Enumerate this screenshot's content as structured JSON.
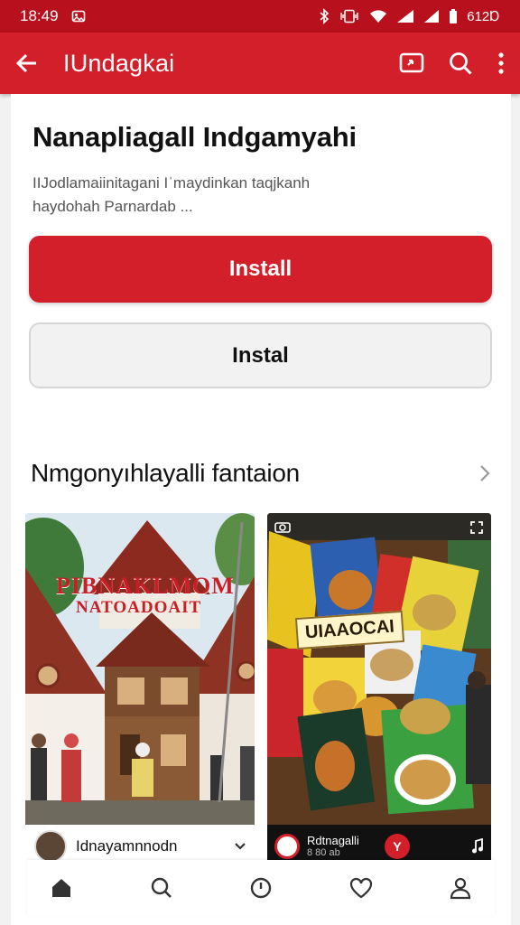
{
  "status_bar": {
    "time": "18:49",
    "left_icon": "gallery-icon",
    "battery_text": "612Ɒ"
  },
  "app_bar": {
    "title": "IUndagkai",
    "back_icon": "arrow-left-icon",
    "actions": [
      "cast-icon",
      "search-icon",
      "more-vertical-icon"
    ]
  },
  "app": {
    "title": "Nanapliagall Indgamyahi",
    "description_line1": "IIJodlamaiinitagani Iˈmaydinkan taqjkanh",
    "description_line2": "haydohah Parnardab ..."
  },
  "buttons": {
    "primary": "Install",
    "secondary": "Instal"
  },
  "section": {
    "title": "Nmgonyıhlayalli fantaion",
    "chevron": "chevron-right-icon"
  },
  "tiles": [
    {
      "overlay_line1": "PIBNAKLMOM",
      "overlay_line2": "NATOADOAIT",
      "author": "Idnayamnnodn",
      "menu_icon": "chevron-down-icon"
    },
    {
      "package_label": "UIAAOCAI",
      "author": "Rdtnagalli",
      "sub": "8 80 ab",
      "badge": "Y",
      "menu_icon": "music-note-icon"
    }
  ],
  "tab_bar": [
    "home-icon",
    "search-icon",
    "clock-icon",
    "heart-icon",
    "profile-icon"
  ],
  "colors": {
    "status_bar": "#b8101c",
    "app_bar": "#d31f2a",
    "primary_button": "#d31f2a"
  }
}
